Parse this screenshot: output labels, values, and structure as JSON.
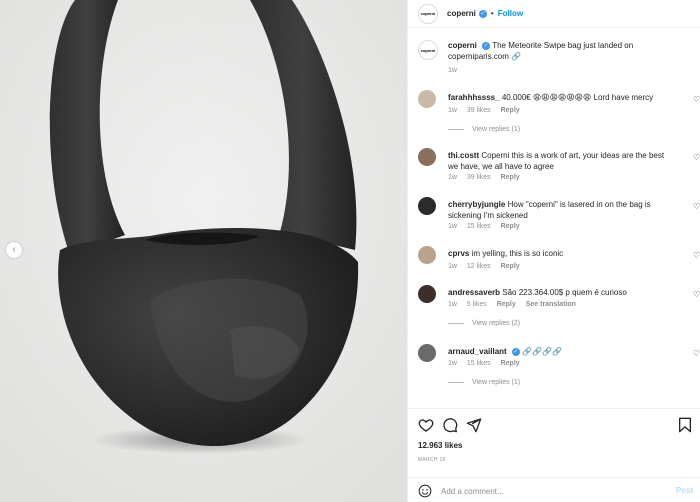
{
  "header": {
    "avatar_text": "coperni",
    "username": "coperni",
    "verified_icon": "verified-badge-icon",
    "separator": "•",
    "follow_label": "Follow"
  },
  "caption": {
    "avatar_text": "coperni",
    "username": "coperni",
    "text": "The Meteorite Swipe bag just landed on coperniparis.com 🔗",
    "time": "1w"
  },
  "comments": [
    {
      "username": "farahhhssss_",
      "text": "40.000€ 😩😩😩😩😩😩😩 Lord have mercy",
      "time": "1w",
      "likes": "39 likes",
      "reply": "Reply",
      "view_replies": "View replies (1)",
      "avatar_color": "#c9b9a6"
    },
    {
      "username": "thi.costt",
      "text": "Coperni this is a work of art, your ideas are the best we have, we all have to agree",
      "time": "1w",
      "likes": "39 likes",
      "reply": "Reply",
      "avatar_color": "#8a6f5c"
    },
    {
      "username": "cherrybyjungle",
      "text": "How \"coperni\" is lasered in on the bag is sickening I'm sickened",
      "time": "1w",
      "likes": "15 likes",
      "reply": "Reply",
      "avatar_color": "#2b2b2b"
    },
    {
      "username": "cprvs",
      "text": "im yelling, this is so iconic",
      "time": "1w",
      "likes": "12 likes",
      "reply": "Reply",
      "avatar_color": "#b8a48c"
    },
    {
      "username": "andressaverb",
      "text": "São 223.364.00$ p quem é curioso",
      "time": "1w",
      "likes": "5 likes",
      "reply": "Reply",
      "translation": "See translation",
      "view_replies": "View replies (2)",
      "avatar_color": "#3c2f2a"
    },
    {
      "username": "arnaud_vaillant",
      "text": "🔗🔗🔗🔗",
      "time": "1w",
      "likes": "15 likes",
      "reply": "Reply",
      "view_replies": "View replies (1)",
      "avatar_color": "#6b6b6b",
      "verified": true
    }
  ],
  "footer": {
    "likes_count": "12.963 likes",
    "date": "MARCH 16",
    "comment_placeholder": "Add a comment...",
    "post_label": "Post"
  },
  "colors": {
    "accent": "#0095f6",
    "verified": "#3897f0",
    "muted": "#8e8e8e"
  },
  "icons": [
    "heart-icon",
    "comment-icon",
    "share-icon",
    "bookmark-icon",
    "emoji-icon",
    "chevron-left-icon"
  ]
}
